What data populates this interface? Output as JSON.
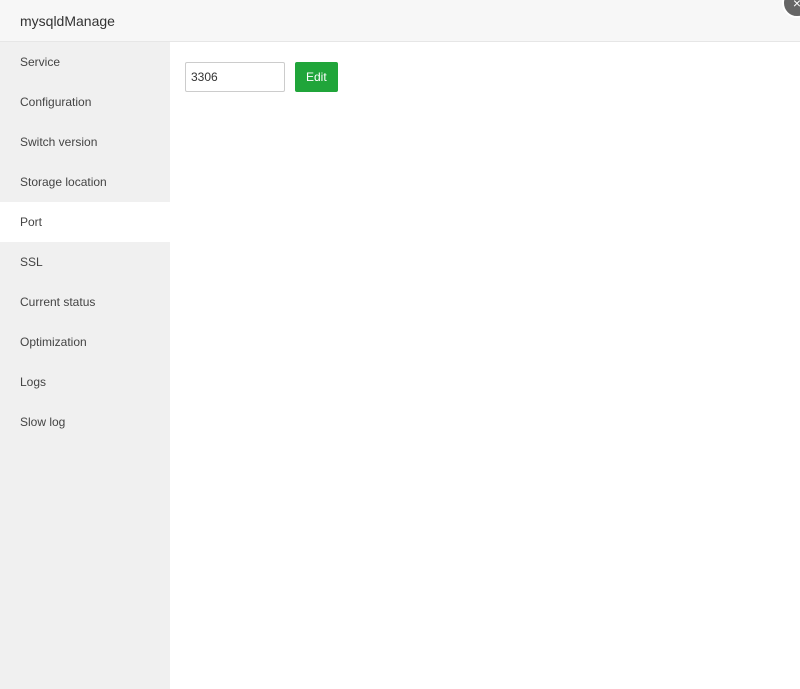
{
  "title": "mysqldManage",
  "close_icon": "×",
  "sidebar": {
    "items": [
      {
        "label": "Service"
      },
      {
        "label": "Configuration"
      },
      {
        "label": "Switch version"
      },
      {
        "label": "Storage location"
      },
      {
        "label": "Port"
      },
      {
        "label": "SSL"
      },
      {
        "label": "Current status"
      },
      {
        "label": "Optimization"
      },
      {
        "label": "Logs"
      },
      {
        "label": "Slow log"
      }
    ],
    "active": 4
  },
  "port": {
    "value": "3306",
    "edit_label": "Edit"
  },
  "colors": {
    "accent": "#20a53a"
  }
}
